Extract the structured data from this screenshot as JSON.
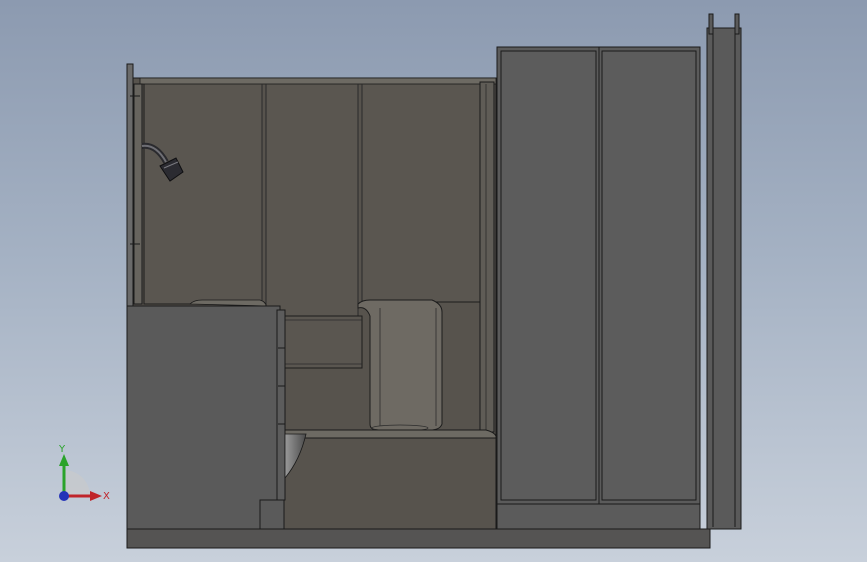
{
  "viewport": {
    "background_top": "#8c9ab0",
    "background_bottom": "#c8d0db",
    "model_face_color": "#57534d",
    "cabinet_color": "#5a5a5a",
    "edge_color": "#1a1a1a"
  },
  "triad": {
    "x_label": "X",
    "y_label": "Y",
    "x_color": "#c0242a",
    "y_color": "#2aa32a",
    "z_color": "#2433b8"
  }
}
